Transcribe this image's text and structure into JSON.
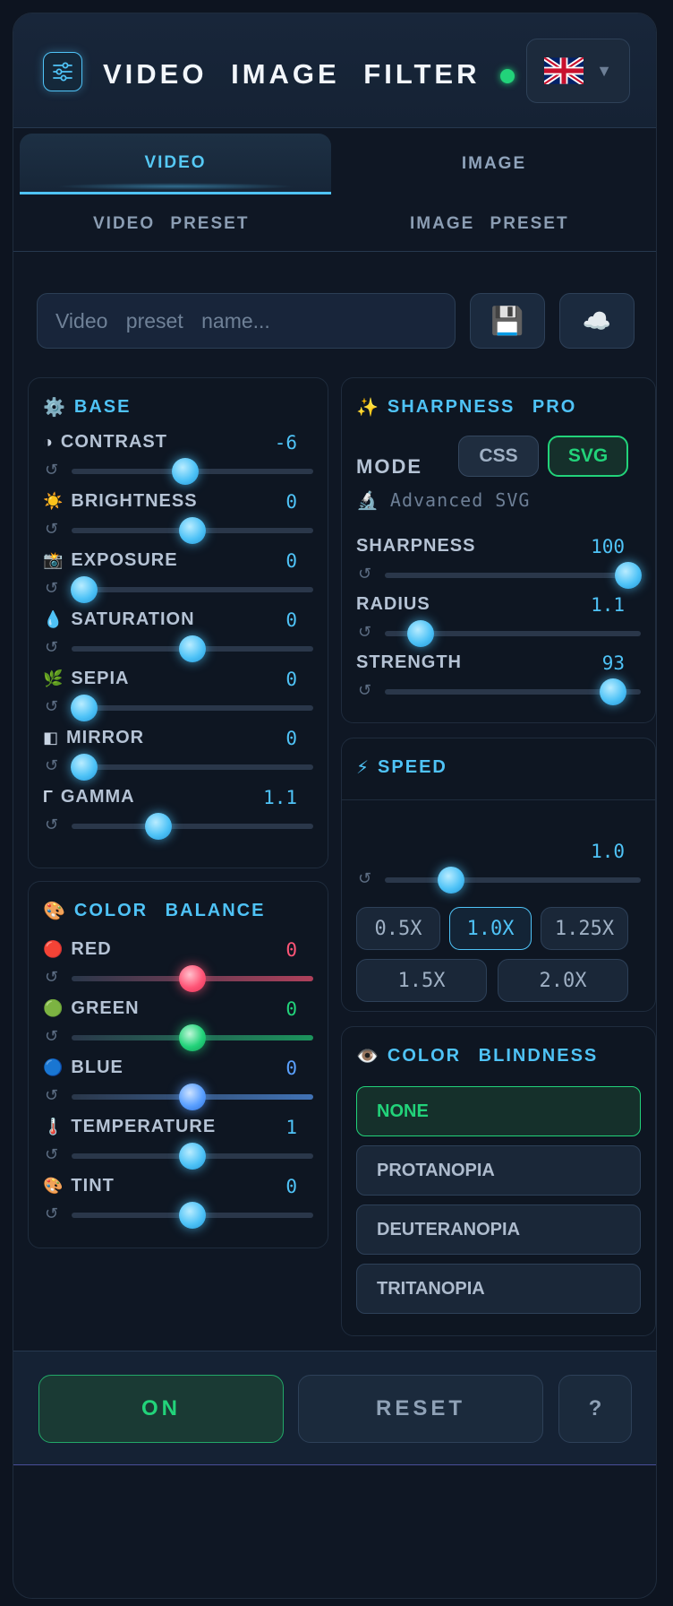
{
  "header": {
    "title": "VIDEO IMAGE FILTER",
    "lang_flag": "uk-flag-icon",
    "status_color": "#22d37a"
  },
  "tabs": [
    {
      "label": "VIDEO",
      "active": true
    },
    {
      "label": "IMAGE",
      "active": false
    }
  ],
  "presets": {
    "video_label": "VIDEO PRESET",
    "image_label": "IMAGE PRESET",
    "placeholder": "Video preset name...",
    "save_icon": "floppy-disk-icon",
    "cloud_icon": "cloud-icon"
  },
  "base": {
    "title": "BASE",
    "items": [
      {
        "icon": "◑",
        "label": "CONTRAST",
        "value": "-6",
        "pos": 0.47
      },
      {
        "icon": "☀️",
        "label": "BRIGHTNESS",
        "value": "0",
        "pos": 0.5
      },
      {
        "icon": "📸",
        "label": "EXPOSURE",
        "value": "0",
        "pos": 0.05
      },
      {
        "icon": "💧",
        "label": "SATURATION",
        "value": "0",
        "pos": 0.5
      },
      {
        "icon": "🌿",
        "label": "SEPIA",
        "value": "0",
        "pos": 0.05
      },
      {
        "icon": "◧",
        "label": "MIRROR",
        "value": "0",
        "pos": 0.05
      },
      {
        "icon": "Γ",
        "label": "GAMMA",
        "value": "1.1",
        "pos": 0.36
      }
    ]
  },
  "color_balance": {
    "title": "COLOR BALANCE",
    "items": [
      {
        "icon": "🔴",
        "label": "RED",
        "value": "0",
        "pos": 0.5,
        "color": "#ff5577"
      },
      {
        "icon": "🟢",
        "label": "GREEN",
        "value": "0",
        "pos": 0.5,
        "color": "#22d37a"
      },
      {
        "icon": "🔵",
        "label": "BLUE",
        "value": "0",
        "pos": 0.5,
        "color": "#5aa0ff"
      },
      {
        "icon": "🌡️",
        "label": "TEMPERATURE",
        "value": "1",
        "pos": 0.5
      },
      {
        "icon": "🎨",
        "label": "TINT",
        "value": "0",
        "pos": 0.5
      }
    ]
  },
  "sharpness": {
    "title": "SHARPNESS PRO",
    "mode_label": "MODE",
    "mode_css": "CSS",
    "mode_svg": "SVG",
    "advanced": "Advanced SVG",
    "items": [
      {
        "label": "SHARPNESS",
        "value": "100",
        "pos": 0.95
      },
      {
        "label": "RADIUS",
        "value": "1.1",
        "pos": 0.14
      },
      {
        "label": "STRENGTH",
        "value": "93",
        "pos": 0.89
      }
    ]
  },
  "speed": {
    "title": "SPEED",
    "value": "1.0",
    "pos": 0.26,
    "chips": [
      "0.5X",
      "1.0X",
      "1.25X",
      "1.5X",
      "2.0X"
    ],
    "active": 1
  },
  "color_blindness": {
    "title": "COLOR BLINDNESS",
    "options": [
      "NONE",
      "PROTANOPIA",
      "DEUTERANOPIA",
      "TRITANOPIA"
    ],
    "active": 0
  },
  "footer": {
    "on_label": "ON",
    "reset_label": "RESET",
    "help_label": "?"
  }
}
